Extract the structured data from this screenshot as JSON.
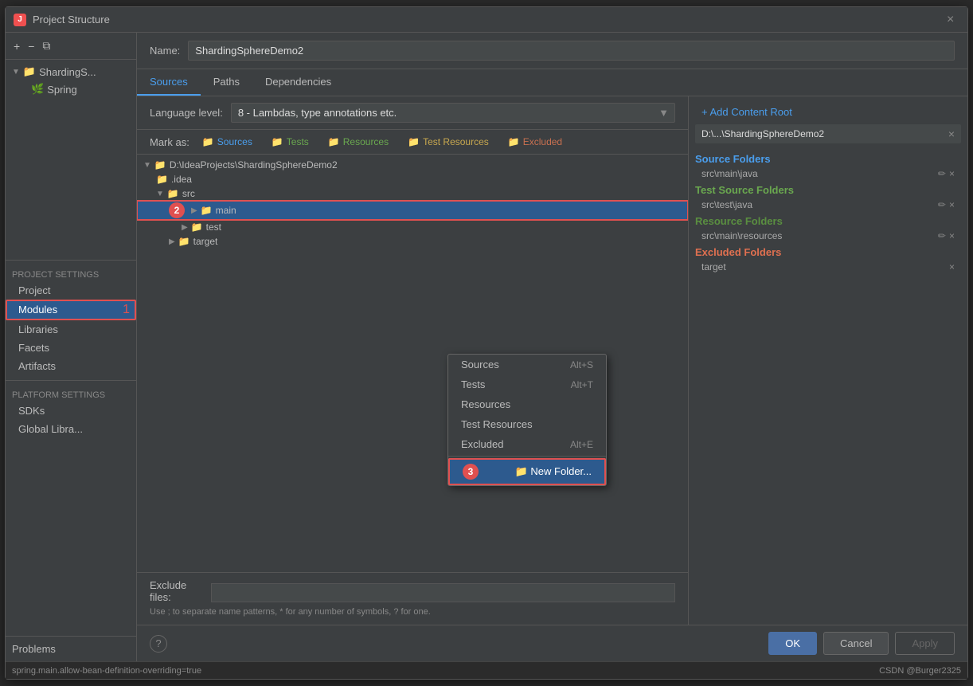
{
  "dialog": {
    "title": "Project Structure",
    "app_icon": "J",
    "close_label": "×"
  },
  "sidebar": {
    "add_btn": "+",
    "remove_btn": "−",
    "copy_btn": "⧉",
    "tree": [
      {
        "label": "ShardingS...",
        "type": "folder",
        "expanded": true
      },
      {
        "label": "Spring",
        "type": "spring",
        "indent": 1
      }
    ],
    "project_settings_label": "Project Settings",
    "nav_items": [
      {
        "id": "project",
        "label": "Project"
      },
      {
        "id": "modules",
        "label": "Modules",
        "active": true,
        "badge": "1"
      },
      {
        "id": "libraries",
        "label": "Libraries"
      },
      {
        "id": "facets",
        "label": "Facets"
      },
      {
        "id": "artifacts",
        "label": "Artifacts"
      }
    ],
    "platform_settings_label": "Platform Settings",
    "platform_nav_items": [
      {
        "id": "sdks",
        "label": "SDKs"
      },
      {
        "id": "global-libs",
        "label": "Global Libra..."
      }
    ],
    "problems_label": "Problems"
  },
  "content": {
    "name_label": "Name:",
    "name_value": "ShardingSphereDemo2",
    "tabs": [
      {
        "id": "sources",
        "label": "Sources",
        "active": true
      },
      {
        "id": "paths",
        "label": "Paths"
      },
      {
        "id": "dependencies",
        "label": "Dependencies"
      }
    ],
    "lang_label": "Language level:",
    "lang_value": "8 - Lambdas, type annotations etc.",
    "mark_as_label": "Mark as:",
    "mark_badges": [
      {
        "id": "sources",
        "label": "Sources",
        "icon": "📁",
        "class": "sources"
      },
      {
        "id": "tests",
        "label": "Tests",
        "icon": "📁",
        "class": "tests"
      },
      {
        "id": "resources",
        "label": "Resources",
        "icon": "📁",
        "class": "resources"
      },
      {
        "id": "test-resources",
        "label": "Test Resources",
        "icon": "📁",
        "class": "test-resources"
      },
      {
        "id": "excluded",
        "label": "Excluded",
        "icon": "📁",
        "class": "excluded"
      }
    ],
    "file_tree": [
      {
        "indent": 0,
        "expanded": true,
        "label": "D:\\IdeaProjects\\ShardingSphereDemo2",
        "type": "folder"
      },
      {
        "indent": 1,
        "label": ".idea",
        "type": "folder"
      },
      {
        "indent": 1,
        "expanded": true,
        "label": "src",
        "type": "folder"
      },
      {
        "indent": 2,
        "label": "main",
        "type": "folder",
        "selected": true,
        "step": "2"
      },
      {
        "indent": 3,
        "label": "test",
        "type": "folder"
      },
      {
        "indent": 2,
        "label": "target",
        "type": "folder"
      }
    ],
    "exclude_files_label": "Exclude files:",
    "exclude_input_placeholder": "",
    "exclude_hint": "Use ; to separate name patterns, * for any number of symbols, ? for one."
  },
  "context_menu": {
    "items": [
      {
        "id": "sources",
        "label": "Sources",
        "shortcut": "Alt+S"
      },
      {
        "id": "tests",
        "label": "Tests",
        "shortcut": "Alt+T"
      },
      {
        "id": "resources",
        "label": "Resources",
        "shortcut": ""
      },
      {
        "id": "test-resources",
        "label": "Test Resources",
        "shortcut": ""
      },
      {
        "id": "excluded",
        "label": "Excluded",
        "shortcut": "Alt+E"
      }
    ],
    "new_folder_label": "📁 New Folder...",
    "new_folder_step": "3"
  },
  "right_panel": {
    "add_content_root_label": "+ Add Content Root",
    "content_root_path": "D:\\...\\ShardingSphereDemo2",
    "sections": [
      {
        "id": "source-folders",
        "title": "Source Folders",
        "color": "blue",
        "entries": [
          {
            "path": "src\\main\\java"
          }
        ]
      },
      {
        "id": "test-source-folders",
        "title": "Test Source Folders",
        "color": "green",
        "entries": [
          {
            "path": "src\\test\\java"
          }
        ]
      },
      {
        "id": "resource-folders",
        "title": "Resource Folders",
        "color": "dark-green",
        "entries": [
          {
            "path": "src\\main\\resources"
          }
        ]
      },
      {
        "id": "excluded-folders",
        "title": "Excluded Folders",
        "color": "red",
        "entries": [
          {
            "path": "target"
          }
        ]
      }
    ]
  },
  "footer": {
    "ok_label": "OK",
    "cancel_label": "Cancel",
    "apply_label": "Apply"
  },
  "status_bar": {
    "code": "spring.main.allow-bean-definition-overriding=true",
    "credit": "CSDN @Burger2325"
  }
}
